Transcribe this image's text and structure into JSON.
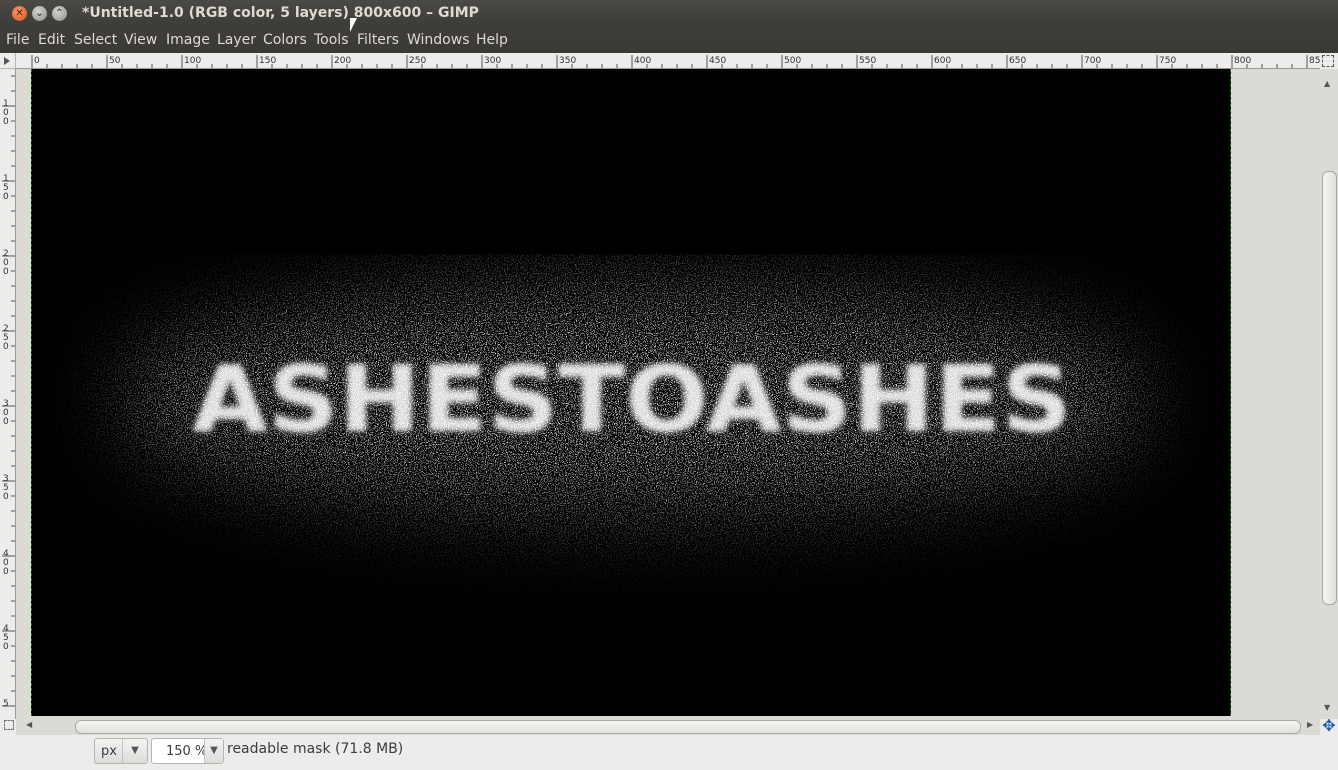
{
  "window": {
    "title": "*Untitled-1.0 (RGB color, 5 layers) 800x600 – GIMP",
    "close_glyph": "✕",
    "minimize_glyph": "⌄",
    "maximize_glyph": "⌃"
  },
  "menubar": {
    "items": [
      "File",
      "Edit",
      "Select",
      "View",
      "Image",
      "Layer",
      "Colors",
      "Tools",
      "Filters",
      "Windows",
      "Help"
    ]
  },
  "rulers": {
    "horizontal_labels": [
      "0",
      "50",
      "100",
      "150",
      "200",
      "250",
      "300",
      "350",
      "400",
      "450",
      "500",
      "550",
      "600",
      "650",
      "700",
      "750",
      "800",
      "85"
    ],
    "vertical_labels": [
      "100",
      "150",
      "200",
      "250",
      "300",
      "350",
      "400",
      "450",
      "5"
    ]
  },
  "canvas": {
    "text": "ASHESTOASHES",
    "background_color": "#000000",
    "text_color": "#ffffff"
  },
  "statusbar": {
    "unit": "px",
    "zoom": "150 %",
    "message": "readable mask (71.8 MB)"
  },
  "icons": {
    "navigate": "navigate-icon",
    "zoom_fit": "zoom-fit-icon",
    "move": "move-icon"
  }
}
